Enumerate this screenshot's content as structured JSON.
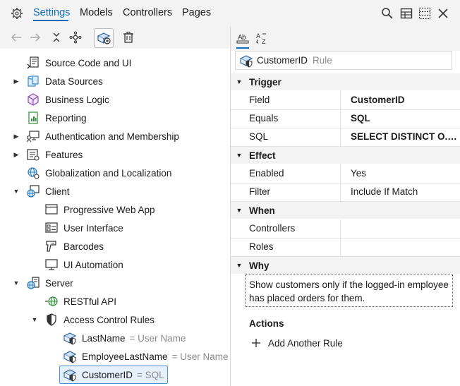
{
  "menu": {
    "tabs": [
      "Settings",
      "Models",
      "Controllers",
      "Pages"
    ],
    "active": "Settings"
  },
  "tree": {
    "items": [
      {
        "label": "Source Code and UI",
        "icon": "source-code-icon"
      },
      {
        "label": "Data Sources",
        "icon": "database-icon"
      },
      {
        "label": "Business Logic",
        "icon": "cube-icon"
      },
      {
        "label": "Reporting",
        "icon": "report-icon"
      },
      {
        "label": "Authentication and Membership",
        "icon": "user-computer-icon"
      },
      {
        "label": "Features",
        "icon": "features-icon"
      },
      {
        "label": "Globalization and Localization",
        "icon": "globe-gear-icon"
      },
      {
        "label": "Client",
        "icon": "client-globe-icon"
      },
      {
        "label": "Progressive Web App",
        "icon": "window-icon"
      },
      {
        "label": "User Interface",
        "icon": "form-icon"
      },
      {
        "label": "Barcodes",
        "icon": "barcode-scanner-icon"
      },
      {
        "label": "UI Automation",
        "icon": "monitor-icon"
      },
      {
        "label": "Server",
        "icon": "server-globe-icon"
      },
      {
        "label": "RESTful API",
        "icon": "rest-api-icon"
      },
      {
        "label": "Access Control Rules",
        "icon": "shield-icon"
      },
      {
        "label": "LastName",
        "suffix": "= User Name",
        "icon": "rule-icon"
      },
      {
        "label": "EmployeeLastName",
        "suffix": "= User Name",
        "icon": "rule-icon"
      },
      {
        "label": "CustomerID",
        "suffix": "= SQL",
        "icon": "rule-icon"
      }
    ]
  },
  "properties": {
    "header_name": "CustomerID",
    "header_type": "Rule",
    "sections": {
      "trigger": "Trigger",
      "effect": "Effect",
      "when": "When",
      "why": "Why"
    },
    "trigger": [
      {
        "name": "Field",
        "value": "CustomerID"
      },
      {
        "name": "Equals",
        "value": "SQL"
      },
      {
        "name": "SQL",
        "value": "SELECT DISTINCT O.C..."
      }
    ],
    "effect": [
      {
        "name": "Enabled",
        "value": "Yes"
      },
      {
        "name": "Filter",
        "value": "Include If Match"
      }
    ],
    "when": [
      {
        "name": "Controllers",
        "value": ""
      },
      {
        "name": "Roles",
        "value": ""
      }
    ],
    "why_text": "Show customers only if the logged-in employee has placed orders for them.",
    "actions_label": "Actions",
    "add_rule_label": "Add Another Rule"
  },
  "colors": {
    "accent": "#0f6cbd",
    "panel": "#f3f3f3",
    "selection_border": "#4a90d9"
  }
}
